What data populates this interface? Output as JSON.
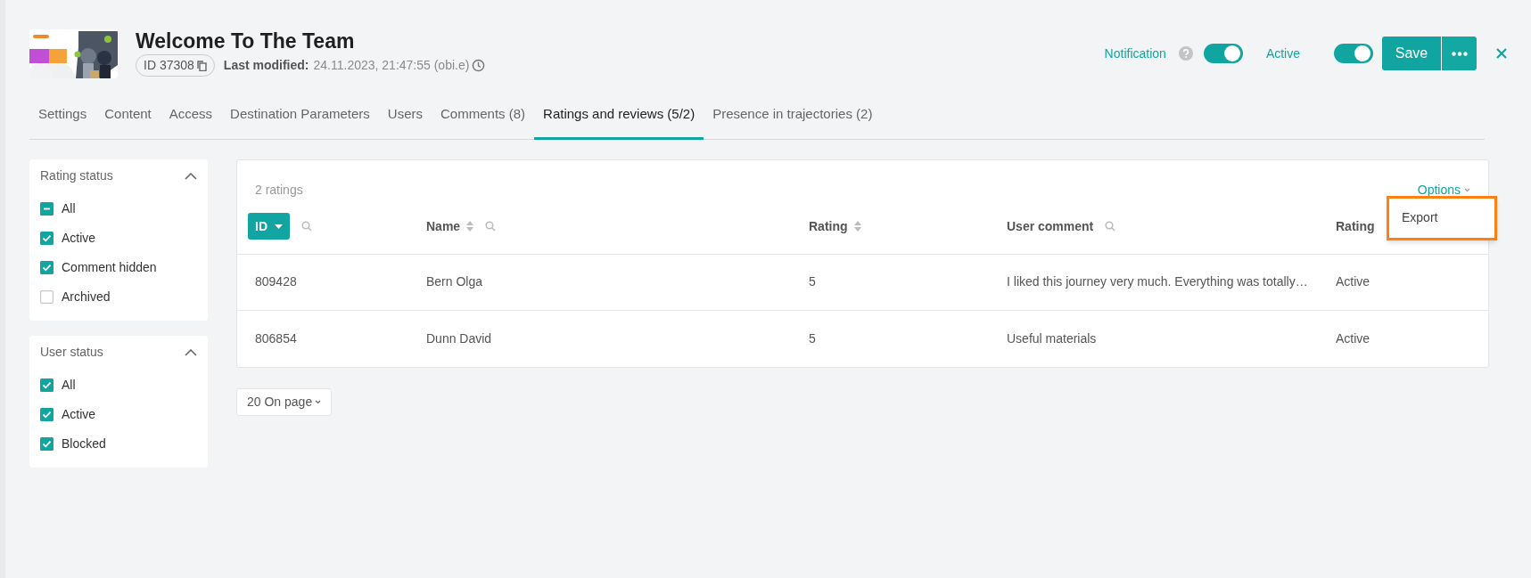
{
  "header": {
    "title": "Welcome To The Team",
    "id_badge": "ID 37308",
    "modified_label": "Last modified:",
    "modified_value": "24.11.2023, 21:47:55 (obi.e)"
  },
  "toggles": [
    {
      "label": "Notification",
      "help": true,
      "on": true
    },
    {
      "label": "Active",
      "help": false,
      "on": true
    }
  ],
  "actions": {
    "save": "Save"
  },
  "tabs": [
    {
      "label": "Settings",
      "selected": false
    },
    {
      "label": "Content",
      "selected": false
    },
    {
      "label": "Access",
      "selected": false
    },
    {
      "label": "Destination Parameters",
      "selected": false
    },
    {
      "label": "Users",
      "selected": false
    },
    {
      "label": "Comments (8)",
      "selected": false
    },
    {
      "label": "Ratings and reviews (5/2)",
      "selected": true
    },
    {
      "label": "Presence in trajectories (2)",
      "selected": false
    }
  ],
  "filters": [
    {
      "title": "Rating status",
      "expanded": true,
      "options": [
        {
          "label": "All",
          "checked": true,
          "mixed": true
        },
        {
          "label": "Active",
          "checked": true,
          "mixed": false
        },
        {
          "label": "Comment hidden",
          "checked": true,
          "mixed": false
        },
        {
          "label": "Archived",
          "checked": false,
          "mixed": false
        }
      ]
    },
    {
      "title": "User status",
      "expanded": true,
      "options": [
        {
          "label": "All",
          "checked": true,
          "mixed": false
        },
        {
          "label": "Active",
          "checked": true,
          "mixed": false
        },
        {
          "label": "Blocked",
          "checked": true,
          "mixed": false
        }
      ]
    }
  ],
  "table": {
    "count": "2 ratings",
    "options": "Options",
    "columns": [
      {
        "label": "ID",
        "sortable": true,
        "sorted": true,
        "search": true
      },
      {
        "label": "Name",
        "sortable": true,
        "sorted": false,
        "search": true
      },
      {
        "label": "Rating",
        "sortable": true,
        "sorted": false,
        "search": false
      },
      {
        "label": "User comment",
        "sortable": false,
        "sorted": false,
        "search": true
      },
      {
        "label": "Rating",
        "sortable": false,
        "sorted": false,
        "search": false
      }
    ],
    "rows": [
      [
        "809428",
        "Bern Olga",
        "5",
        "I liked this journey very much. Everything was totally…",
        "Active"
      ],
      [
        "806854",
        "Dunn David",
        "5",
        "Useful materials",
        "Active"
      ]
    ]
  },
  "menu": {
    "items": [
      "Export"
    ]
  },
  "pagination": {
    "per_page": "20 On page"
  }
}
